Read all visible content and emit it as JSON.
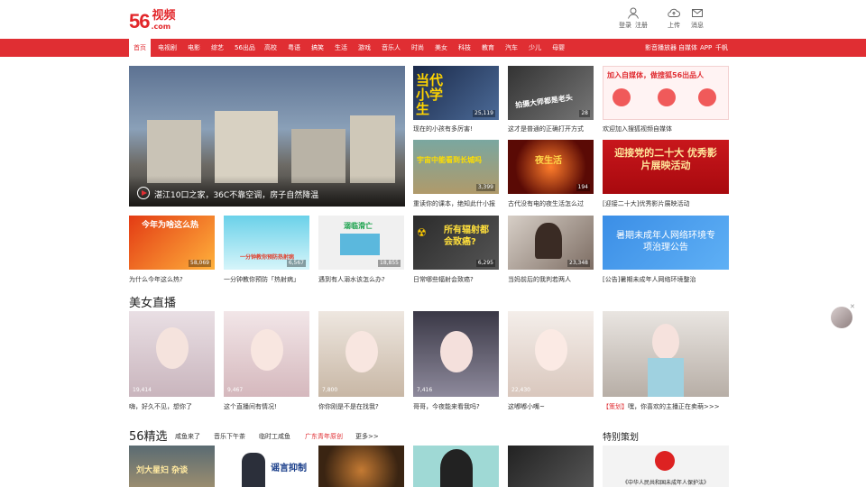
{
  "logo": {
    "num": "56",
    "com": ".com",
    "cn": "视频"
  },
  "header_user": [
    {
      "label": "登录",
      "icon": "user-icon"
    },
    {
      "label": "注册",
      "icon": ""
    },
    {
      "label": "上传",
      "icon": "upload-cloud-icon"
    },
    {
      "label": "消息",
      "icon": "mail-icon"
    }
  ],
  "nav": {
    "left": [
      "首页",
      "电视剧",
      "电影",
      "综艺",
      "56出品",
      "高校",
      "粤语",
      "搞笑",
      "生活",
      "游戏",
      "音乐人",
      "时尚",
      "美女",
      "科技",
      "教育",
      "汽车",
      "少儿",
      "母婴"
    ],
    "right": [
      "影音播放器",
      "自媒体",
      "APP",
      "千帆"
    ],
    "colors": {
      "bar": "#e02e33",
      "active_text": "#e02e33"
    }
  },
  "hero": {
    "caption": "湛江10口之家，36C不靠空调，房子自然降温"
  },
  "grid": [
    {
      "caption": "现在的小孩有多厉害!",
      "count": "25,119",
      "art": "当代小学生"
    },
    {
      "caption": "这才是普通的正确打开方式",
      "count": "28",
      "art": "拍摄大师都是老头"
    },
    {
      "caption": "欢迎加入搜狐视频自媒体",
      "count": "",
      "art": "加入自媒体，做搜狐56出品人"
    },
    {
      "caption": "重读你的课本，绝知此什小报",
      "count": "3,399",
      "art": "宇宙中能看到长城吗"
    },
    {
      "caption": "古代没有电的夜生活怎么过",
      "count": "194",
      "art": "夜生活"
    },
    {
      "caption": "[迎接二十大]优秀影片展映活动",
      "count": "",
      "art": "迎接党的二十大 优秀影片展映活动"
    },
    {
      "caption": "为什么今年这么热?",
      "count": "58,069",
      "art": "今年为啥这么热"
    },
    {
      "caption": "一分钟教你预防「热射病」",
      "count": "6,567",
      "art": "一分钟教你预防热射病"
    },
    {
      "caption": "遇到有人溺水该怎么办?",
      "count": "18,855",
      "art": "溺临滑亡"
    },
    {
      "caption": "日常哪些辐射会致癌?",
      "count": "6,295",
      "art": "所有辐射都会致癌?"
    },
    {
      "caption": "当妈前后的我判若两人",
      "count": "23,348",
      "art": ""
    },
    {
      "caption": "[公告]暑期未成年人网络环境整治",
      "count": "",
      "art": "暑期未成年人网络环境专项治理公告"
    }
  ],
  "live_title": "美女直播",
  "live": [
    {
      "caption": "嗨，好久不见，想你了",
      "count": "19,414"
    },
    {
      "caption": "这个直播间有情况!",
      "count": "9,467"
    },
    {
      "caption": "你你刚是不是在找我?",
      "count": "7,800"
    },
    {
      "caption": "哥哥，今夜能来看我吗?",
      "count": "7,416"
    },
    {
      "caption": "这嘟嘟小嘴~",
      "count": "22,430"
    },
    {
      "caption_tag": "【策划】",
      "caption": "嘿，你喜欢的主播正在卖萌>>>",
      "count": ""
    }
  ],
  "jingxuan": {
    "title": "56精选",
    "cats": [
      "咸鱼来了",
      "音乐下午茶",
      "临时工咸鱼",
      "广东青年原创",
      "更多>>"
    ],
    "special": "特别策划",
    "thumb_texts": [
      "刘大星妇 杂谈",
      "谣言抑制",
      "",
      "",
      "",
      "《中华人民共和国未成年人保护法》"
    ]
  }
}
